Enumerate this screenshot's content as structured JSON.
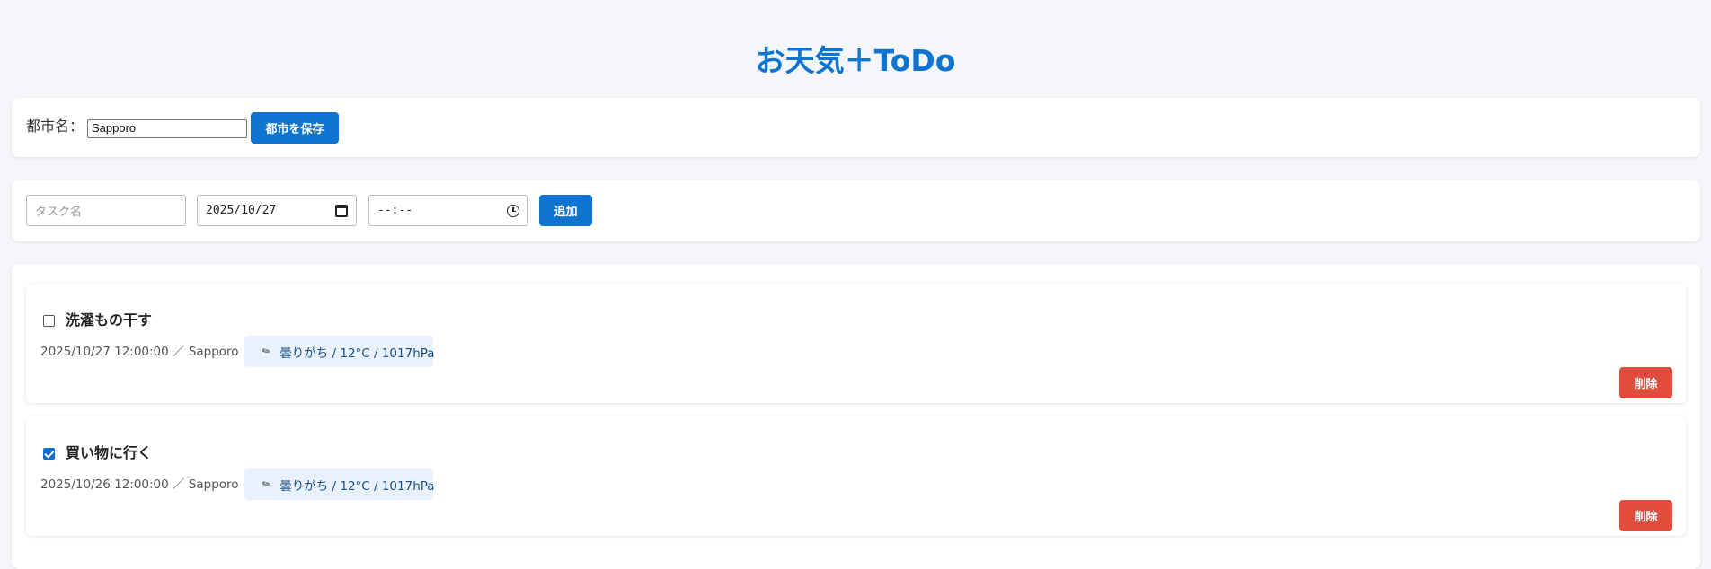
{
  "app": {
    "title": "お天気＋ToDo"
  },
  "city": {
    "label": "都市名：",
    "value": "Sapporo",
    "save_label": "都市を保存"
  },
  "add_form": {
    "task_placeholder": "タスク名",
    "date_value": "2025/10/27",
    "time_value": "--:--",
    "add_label": "追加"
  },
  "tasks": [
    {
      "title": "洗濯もの干す",
      "checked": false,
      "meta": "2025/10/27 12:00:00 ／ Sapporo",
      "weather": "曇りがち / 12°C / 1017hPa",
      "weather_icon": "cloud-icon",
      "delete_label": "削除"
    },
    {
      "title": "買い物に行く",
      "checked": true,
      "meta": "2025/10/26 12:00:00 ／ Sapporo",
      "weather": "曇りがち / 12°C / 1017hPa",
      "weather_icon": "cloud-icon",
      "delete_label": "削除"
    }
  ],
  "colors": {
    "accent": "#0f74d0",
    "danger": "#e24c3c",
    "badge_bg": "#e8f1fc",
    "page_bg": "#f4f6fa"
  }
}
